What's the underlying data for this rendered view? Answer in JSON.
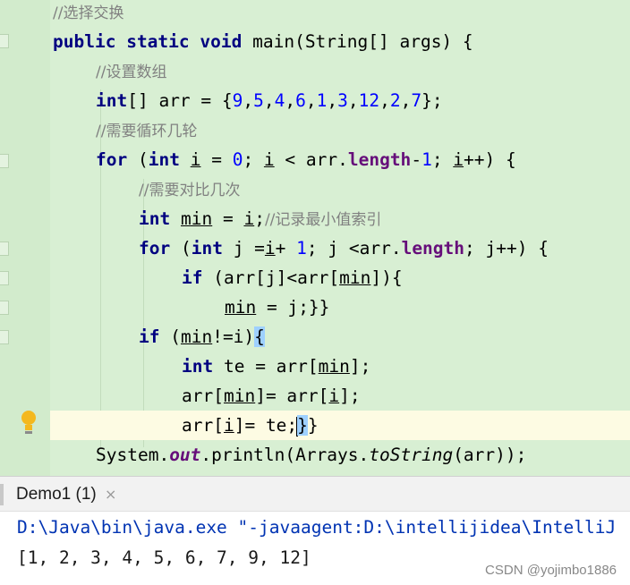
{
  "editor": {
    "comments": {
      "select_swap": "//选择交换",
      "set_array": "//设置数组",
      "rounds": "//需要循环几轮",
      "compares": "//需要对比几次",
      "record_min": "//记录最小值索引"
    },
    "keywords": {
      "public": "public",
      "static": "static",
      "void": "void",
      "int": "int",
      "for": "for",
      "if": "if"
    },
    "main_signature_rest": " main(String[] args) {",
    "array_decl_rest": "[] arr = {",
    "array_values": [
      "9",
      "5",
      "4",
      "6",
      "1",
      "3",
      "12",
      "2",
      "7"
    ],
    "array_close": "};",
    "length_field": "length",
    "out_field": "out",
    "to_string_method": "toString"
  },
  "console": {
    "tab_label": "Demo1 (1)",
    "close_glyph": "×",
    "command": "D:\\Java\\bin\\java.exe \"-javaagent:D:\\intellijidea\\IntelliJ",
    "result": "[1, 2, 3, 4, 5, 6, 7, 9, 12]"
  },
  "watermark": "CSDN @yojimbo1886",
  "colors": {
    "editor_bg": "#d8efd3",
    "current_line": "#fdfbe3",
    "keyword": "#000080",
    "number": "#0000ff",
    "comment": "#808080",
    "field": "#660e7a",
    "console_cmd": "#0033b3",
    "bulb": "#f4b81e"
  },
  "icons": {
    "gutter_intention": "lightbulb-icon",
    "tab_close": "close-icon"
  }
}
